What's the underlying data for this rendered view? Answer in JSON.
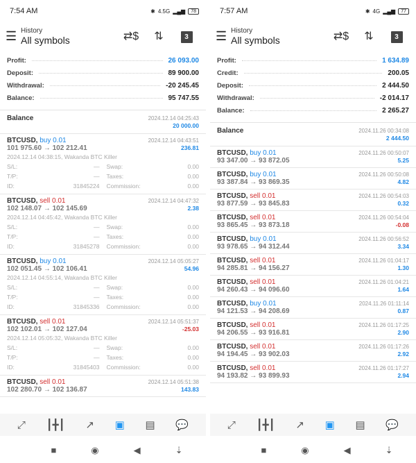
{
  "screens": [
    {
      "status": {
        "time": "7:54 AM",
        "network": "4.5G",
        "battery": "78"
      },
      "header": {
        "subtitle": "History",
        "title": "All symbols"
      },
      "summary": [
        {
          "label": "Profit:",
          "value": "26 093.00",
          "highlight": true
        },
        {
          "label": "Deposit:",
          "value": "89 900.00"
        },
        {
          "label": "Withdrawal:",
          "value": "-20 245.45"
        },
        {
          "label": "Balance:",
          "value": "95 747.55"
        }
      ],
      "balance_entry": {
        "label": "Balance",
        "date": "2024.12.14 04:25:43",
        "amount": "20 000.00"
      },
      "trades": [
        {
          "symbol": "BTCUSD,",
          "side": "buy 0.01",
          "dir": "buy",
          "date": "2024.12.14 04:43:51",
          "prices": "101 975.60 → 102 212.41",
          "profit": "236.81",
          "open": "2024.12.14 04:38:15, Wakanda BTC Killer",
          "sl": "—",
          "tp": "—",
          "id": "31845224",
          "swap": "0.00",
          "taxes": "0.00",
          "commission": "0.00"
        },
        {
          "symbol": "BTCUSD,",
          "side": "sell 0.01",
          "dir": "sell",
          "date": "2024.12.14 04:47:32",
          "prices": "102 148.07 → 102 145.69",
          "profit": "2.38",
          "open": "2024.12.14 04:45:42, Wakanda BTC Killer",
          "sl": "—",
          "tp": "—",
          "id": "31845278",
          "swap": "0.00",
          "taxes": "0.00",
          "commission": "0.00"
        },
        {
          "symbol": "BTCUSD,",
          "side": "buy 0.01",
          "dir": "buy",
          "date": "2024.12.14 05:05:27",
          "prices": "102 051.45 → 102 106.41",
          "profit": "54.96",
          "open": "2024.12.14 04:55:14, Wakanda BTC Killer",
          "sl": "—",
          "tp": "—",
          "id": "31845336",
          "swap": "0.00",
          "taxes": "0.00",
          "commission": "0.00"
        },
        {
          "symbol": "BTCUSD,",
          "side": "sell 0.01",
          "dir": "sell",
          "date": "2024.12.14 05:51:37",
          "prices": "102 102.01 → 102 127.04",
          "profit": "-25.03",
          "open": "2024.12.14 05:05:32, Wakanda BTC Killer",
          "sl": "—",
          "tp": "—",
          "id": "31845403",
          "swap": "0.00",
          "taxes": "0.00",
          "commission": "0.00"
        },
        {
          "symbol": "BTCUSD,",
          "side": "sell 0.01",
          "dir": "sell",
          "date": "2024.12.14 05:51:38",
          "prices": "102 280.70 → 102 136.87",
          "profit": "143.83"
        }
      ]
    },
    {
      "status": {
        "time": "7:57 AM",
        "network": "4G",
        "battery": "77"
      },
      "header": {
        "subtitle": "History",
        "title": "All symbols"
      },
      "summary": [
        {
          "label": "Profit:",
          "value": "1 634.89",
          "highlight": true
        },
        {
          "label": "Credit:",
          "value": "200.05"
        },
        {
          "label": "Deposit:",
          "value": "2 444.50"
        },
        {
          "label": "Withdrawal:",
          "value": "-2 014.17"
        },
        {
          "label": "Balance:",
          "value": "2 265.27"
        }
      ],
      "balance_entry": {
        "label": "Balance",
        "date": "2024.11.26 00:34:08",
        "amount": "2 444.50"
      },
      "trades": [
        {
          "symbol": "BTCUSD,",
          "side": "buy 0.01",
          "dir": "buy",
          "date": "2024.11.26 00:50:07",
          "prices": "93 347.00 → 93 872.05",
          "profit": "5.25"
        },
        {
          "symbol": "BTCUSD,",
          "side": "buy 0.01",
          "dir": "buy",
          "date": "2024.11.26 00:50:08",
          "prices": "93 387.84 → 93 869.35",
          "profit": "4.82"
        },
        {
          "symbol": "BTCUSD,",
          "side": "sell 0.01",
          "dir": "sell",
          "date": "2024.11.26 00:54:03",
          "prices": "93 877.59 → 93 845.83",
          "profit": "0.32"
        },
        {
          "symbol": "BTCUSD,",
          "side": "sell 0.01",
          "dir": "sell",
          "date": "2024.11.26 00:54:04",
          "prices": "93 865.45 → 93 873.18",
          "profit": "-0.08"
        },
        {
          "symbol": "BTCUSD,",
          "side": "buy 0.01",
          "dir": "buy",
          "date": "2024.11.26 00:56:52",
          "prices": "93 978.65 → 94 312.44",
          "profit": "3.34"
        },
        {
          "symbol": "BTCUSD,",
          "side": "sell 0.01",
          "dir": "sell",
          "date": "2024.11.26 01:04:17",
          "prices": "94 285.81 → 94 156.27",
          "profit": "1.30"
        },
        {
          "symbol": "BTCUSD,",
          "side": "sell 0.01",
          "dir": "sell",
          "date": "2024.11.26 01:04:21",
          "prices": "94 260.43 → 94 096.60",
          "profit": "1.64"
        },
        {
          "symbol": "BTCUSD,",
          "side": "buy 0.01",
          "dir": "buy",
          "date": "2024.11.26 01:11:14",
          "prices": "94 121.53 → 94 208.69",
          "profit": "0.87"
        },
        {
          "symbol": "BTCUSD,",
          "side": "sell 0.01",
          "dir": "sell",
          "date": "2024.11.26 01:17:25",
          "prices": "94 206.55 → 93 916.81",
          "profit": "2.90"
        },
        {
          "symbol": "BTCUSD,",
          "side": "sell 0.01",
          "dir": "sell",
          "date": "2024.11.26 01:17:26",
          "prices": "94 194.45 → 93 902.03",
          "profit": "2.92"
        },
        {
          "symbol": "BTCUSD,",
          "side": "sell 0.01",
          "dir": "sell",
          "date": "2024.11.26 01:17:27",
          "prices": "94 193.82 → 93 899.93",
          "profit": "2.94"
        }
      ]
    }
  ],
  "labels": {
    "sl": "S/L:",
    "tp": "T/P:",
    "id": "ID:",
    "swap": "Swap:",
    "taxes": "Taxes:",
    "commission": "Commission:"
  },
  "icons": {
    "menu": "☰",
    "currency_exchange": "⇄$",
    "sort": "⇅",
    "calendar_day": "3",
    "tabs": [
      {
        "name": "quotes-icon",
        "glyph": "⤢"
      },
      {
        "name": "chart-candles-icon",
        "glyph": "┃╋┃"
      },
      {
        "name": "trade-icon",
        "glyph": "↗"
      },
      {
        "name": "history-inbox-icon",
        "glyph": "▣",
        "active": true
      },
      {
        "name": "news-icon",
        "glyph": "▤"
      },
      {
        "name": "chat-icon",
        "glyph": "💬"
      }
    ],
    "sysnav": [
      "■",
      "◉",
      "◀",
      "⇣"
    ]
  },
  "colors": {
    "accent": "#1e88e5",
    "loss": "#d32f2f",
    "active_tab": "#2196f3"
  }
}
